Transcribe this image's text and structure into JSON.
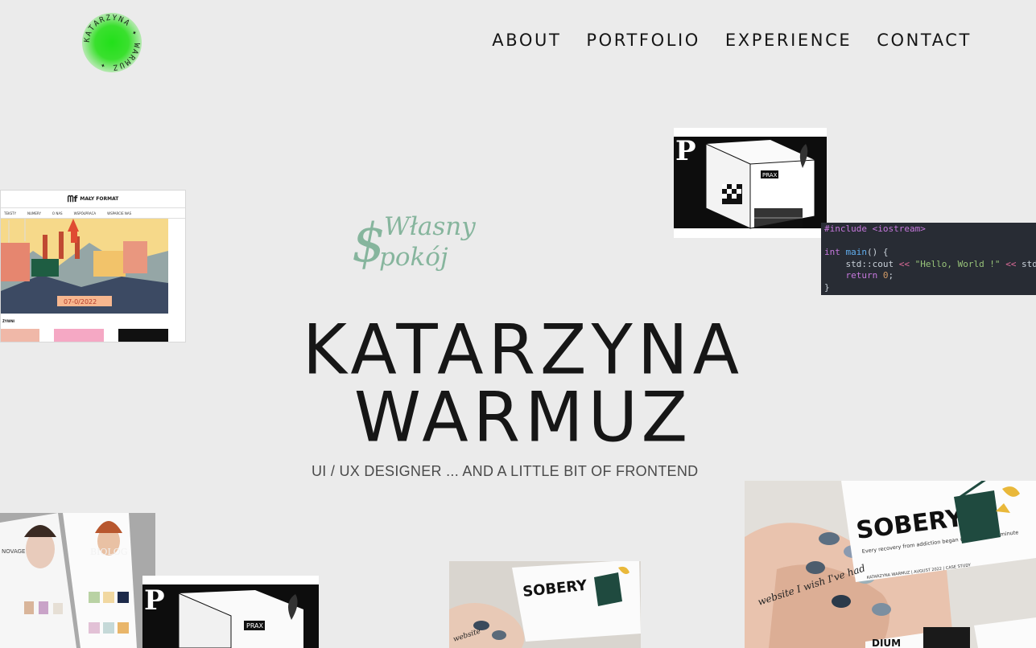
{
  "logo": {
    "ring_text": "KATARZYNA ✦ WARMUZ ✦",
    "color": "#22e01a"
  },
  "nav": {
    "items": [
      {
        "label": "ABOUT"
      },
      {
        "label": "PORTFOLIO"
      },
      {
        "label": "EXPERIENCE"
      },
      {
        "label": "CONTACT"
      }
    ]
  },
  "hero": {
    "first_name": "KATARZYNA",
    "last_name": "WARMUZ",
    "subtitle": "UI / UX DESIGNER ... AND A LITTLE BIT OF FRONTEND"
  },
  "script_logo": {
    "initial": "$",
    "line1": "Własny",
    "line2": "pokój",
    "color": "#86b59d"
  },
  "magazine": {
    "brand": "MAŁY FORMAT",
    "menu": [
      "TEKSTY",
      "NUMERY",
      "O NAS",
      "WSPÓŁPRACA",
      "WSPARCIE NAS"
    ],
    "date_badge": "07-0/2022",
    "section": "ŻYWNI"
  },
  "code": {
    "lines": [
      "#include <iostream>",
      "",
      "int main() {",
      "    std::cout << \"Hello, World !\" << std::",
      "    return 0;",
      "}"
    ]
  },
  "pdraw": {
    "sign": "PRAX",
    "letter": "P"
  },
  "cosmetics": {
    "brand": "NOVAGE",
    "brand2": "BIOLOG"
  },
  "sobery": {
    "title": "SOBERY",
    "tagline": "Every recovery from addiction began with one sober minute",
    "credit": "KATARZYNA WARMUZ | AUGUST 2022 | CASE STUDY",
    "nails_text": "website I wish I've had",
    "extra": "DIUM"
  }
}
